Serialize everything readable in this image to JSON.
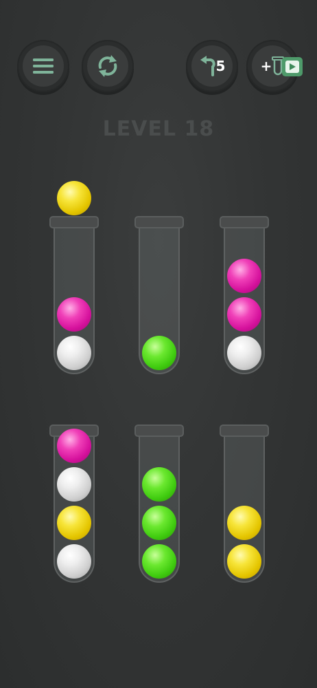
{
  "level_title": "LEVEL 18",
  "toolbar": {
    "menu_icon": "hamburger-menu-icon",
    "restart_icon": "restart-icon",
    "undo_icon": "undo-arrow-icon",
    "undo_count": "5",
    "add_tube_plus": "+",
    "add_tube_icon": "test-tube-icon",
    "video_icon": "play-video-icon"
  },
  "colors": {
    "yellow": "#f0d81a",
    "magenta": "#e3209f",
    "white": "#e0e0e0",
    "green": "#55d81c",
    "background": "#333535"
  },
  "game": {
    "held_ball": "yellow",
    "held_over_tube": 1,
    "tube_capacity": 4,
    "tubes": [
      {
        "balls_bottom_to_top": [
          "white",
          "magenta"
        ]
      },
      {
        "balls_bottom_to_top": [
          "green"
        ]
      },
      {
        "balls_bottom_to_top": [
          "white",
          "magenta",
          "magenta"
        ]
      },
      {
        "balls_bottom_to_top": [
          "white",
          "yellow",
          "white",
          "magenta"
        ]
      },
      {
        "balls_bottom_to_top": [
          "green",
          "green",
          "green"
        ]
      },
      {
        "balls_bottom_to_top": [
          "yellow",
          "yellow"
        ]
      }
    ]
  }
}
